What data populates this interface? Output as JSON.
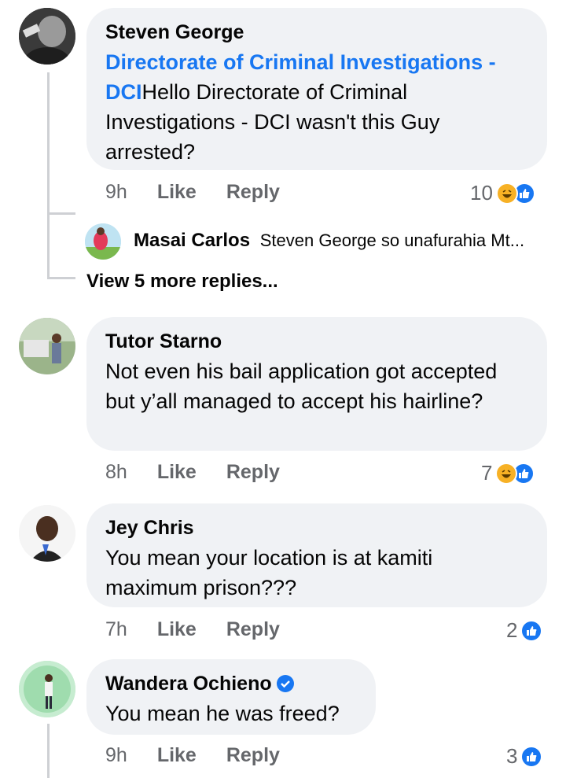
{
  "comments": [
    {
      "author": "Steven George",
      "mention": "Directorate of Criminal Investigations - DCI",
      "text_line1_rest": "Hello Directorate of Criminal Investigations - DCI  wasn't this Guy arrested?",
      "time": "9h",
      "like": "Like",
      "reply": "Reply",
      "reactions": "10"
    },
    {
      "author": "Tutor Starno",
      "text": "Not even his bail application got accepted but y’all managed to accept his hairline?",
      "time": "8h",
      "like": "Like",
      "reply": "Reply",
      "reactions": "7"
    },
    {
      "author": "Jey Chris",
      "text": "You mean your location is at kamiti maximum prison???",
      "time": "7h",
      "like": "Like",
      "reply": "Reply",
      "reactions": "2"
    },
    {
      "author": "Wandera Ochieno",
      "text": "You mean he was freed?",
      "time": "9h",
      "like": "Like",
      "reply": "Reply",
      "reactions": "3"
    }
  ],
  "reply_preview": {
    "author": "Masai Carlos",
    "text": "Steven George so unafurahia Mt..."
  },
  "view_more": "View 5 more replies...",
  "colors": {
    "accent": "#1877f2",
    "bubble": "#f0f2f5",
    "muted": "#65676b",
    "haha": "#f7b125"
  }
}
